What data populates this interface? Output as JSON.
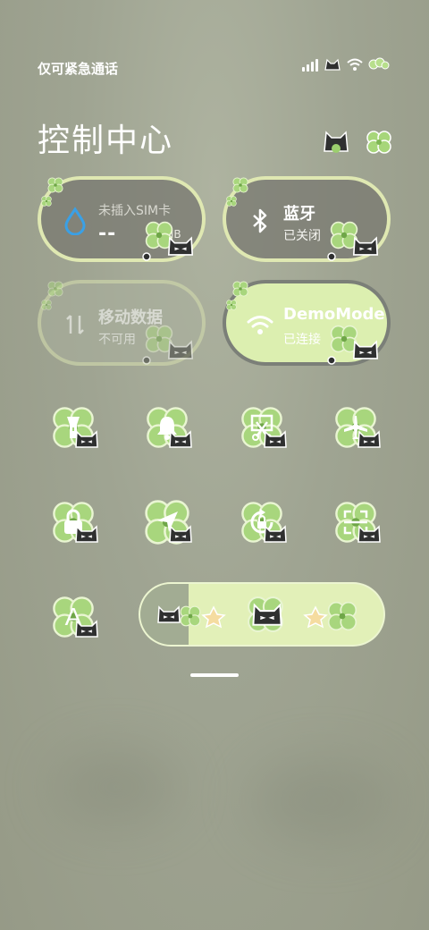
{
  "status": {
    "carrier": "仅可紧急通话",
    "icons": [
      "signal-icon",
      "cat-sticker-icon",
      "wifi-icon",
      "clover-icon"
    ]
  },
  "header": {
    "title": "控制中心",
    "icons": [
      "cat-edit-icon",
      "clover-settings-icon"
    ]
  },
  "tiles": {
    "data_usage": {
      "label": "未插入SIM卡",
      "value": "--",
      "unit": "MB",
      "icon": "water-drop-icon"
    },
    "bluetooth": {
      "label": "蓝牙",
      "status": "已关闭",
      "icon": "bluetooth-icon"
    },
    "mobile_data": {
      "label": "移动数据",
      "status": "不可用",
      "icon": "mobile-data-icon"
    },
    "wifi": {
      "label": "DemoMode",
      "status": "已连接",
      "icon": "wifi-icon"
    }
  },
  "toggles": [
    {
      "name": "flashlight",
      "icon": "flashlight-icon"
    },
    {
      "name": "notifications",
      "icon": "bell-icon"
    },
    {
      "name": "screenshot",
      "icon": "scissors-icon"
    },
    {
      "name": "airplane-mode",
      "icon": "airplane-icon"
    },
    {
      "name": "lock-screen",
      "icon": "lock-icon"
    },
    {
      "name": "location",
      "icon": "location-arrow-icon"
    },
    {
      "name": "rotation-lock",
      "icon": "rotation-lock-icon"
    },
    {
      "name": "scanner",
      "icon": "scan-icon"
    },
    {
      "name": "font-size",
      "icon": "font-a-icon",
      "glyph": "A"
    }
  ],
  "brightness": {
    "level": 0.2
  },
  "colors": {
    "accent": "#dcefb0",
    "tile_border": "#dfe8b2",
    "clover": "#9ccf6e",
    "cat": "#2f3030",
    "background": "#9fa492"
  }
}
